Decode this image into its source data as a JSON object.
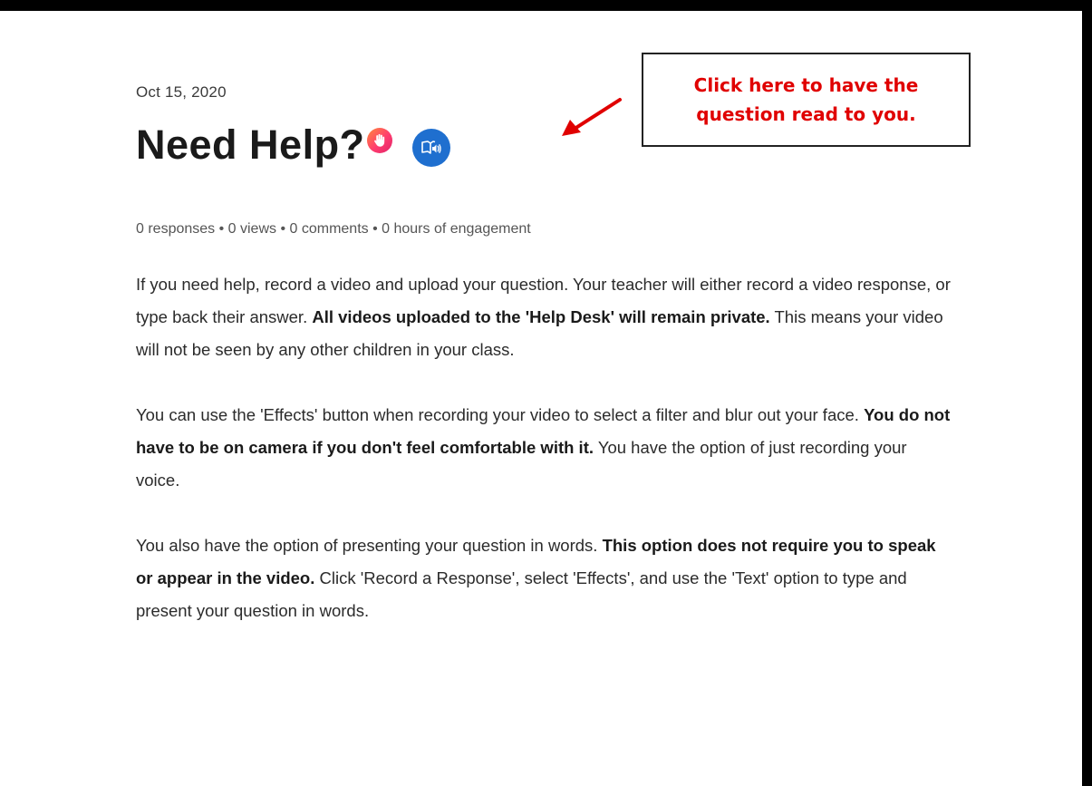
{
  "post": {
    "date": "Oct 15, 2020",
    "title": "Need Help?",
    "stats": "0 responses • 0 views • 0 comments • 0 hours of engagement"
  },
  "icons": {
    "hand": "raised-hand-icon",
    "immersive_reader": "immersive-reader-icon"
  },
  "callout": {
    "line1": "Click here to have the",
    "line2": "question read to you."
  },
  "colors": {
    "callout_text": "#e00000",
    "arrow": "#e00000",
    "reader_button": "#1f6fcf",
    "hand_badge": "#ff3d6e"
  },
  "body": {
    "p1": {
      "a": "If you need help, record a video and upload your question. Your teacher will either record a video response, or type back their answer. ",
      "b": "All videos uploaded to the 'Help Desk' will remain private.",
      "c": " This means your video will not be seen by any other children in your class."
    },
    "p2": {
      "a": "You can use the 'Effects' button when recording your video to select a filter and blur out your face. ",
      "b": "You do not have to be on camera if you don't feel comfortable with it.",
      "c": " You have the option of just recording your voice."
    },
    "p3": {
      "a": "You also have the option of presenting your question in words. ",
      "b": "This option does not require you to speak or appear in the video.",
      "c": "  Click 'Record a Response', select 'Effects', and use the 'Text' option to type and present your question in words."
    }
  }
}
